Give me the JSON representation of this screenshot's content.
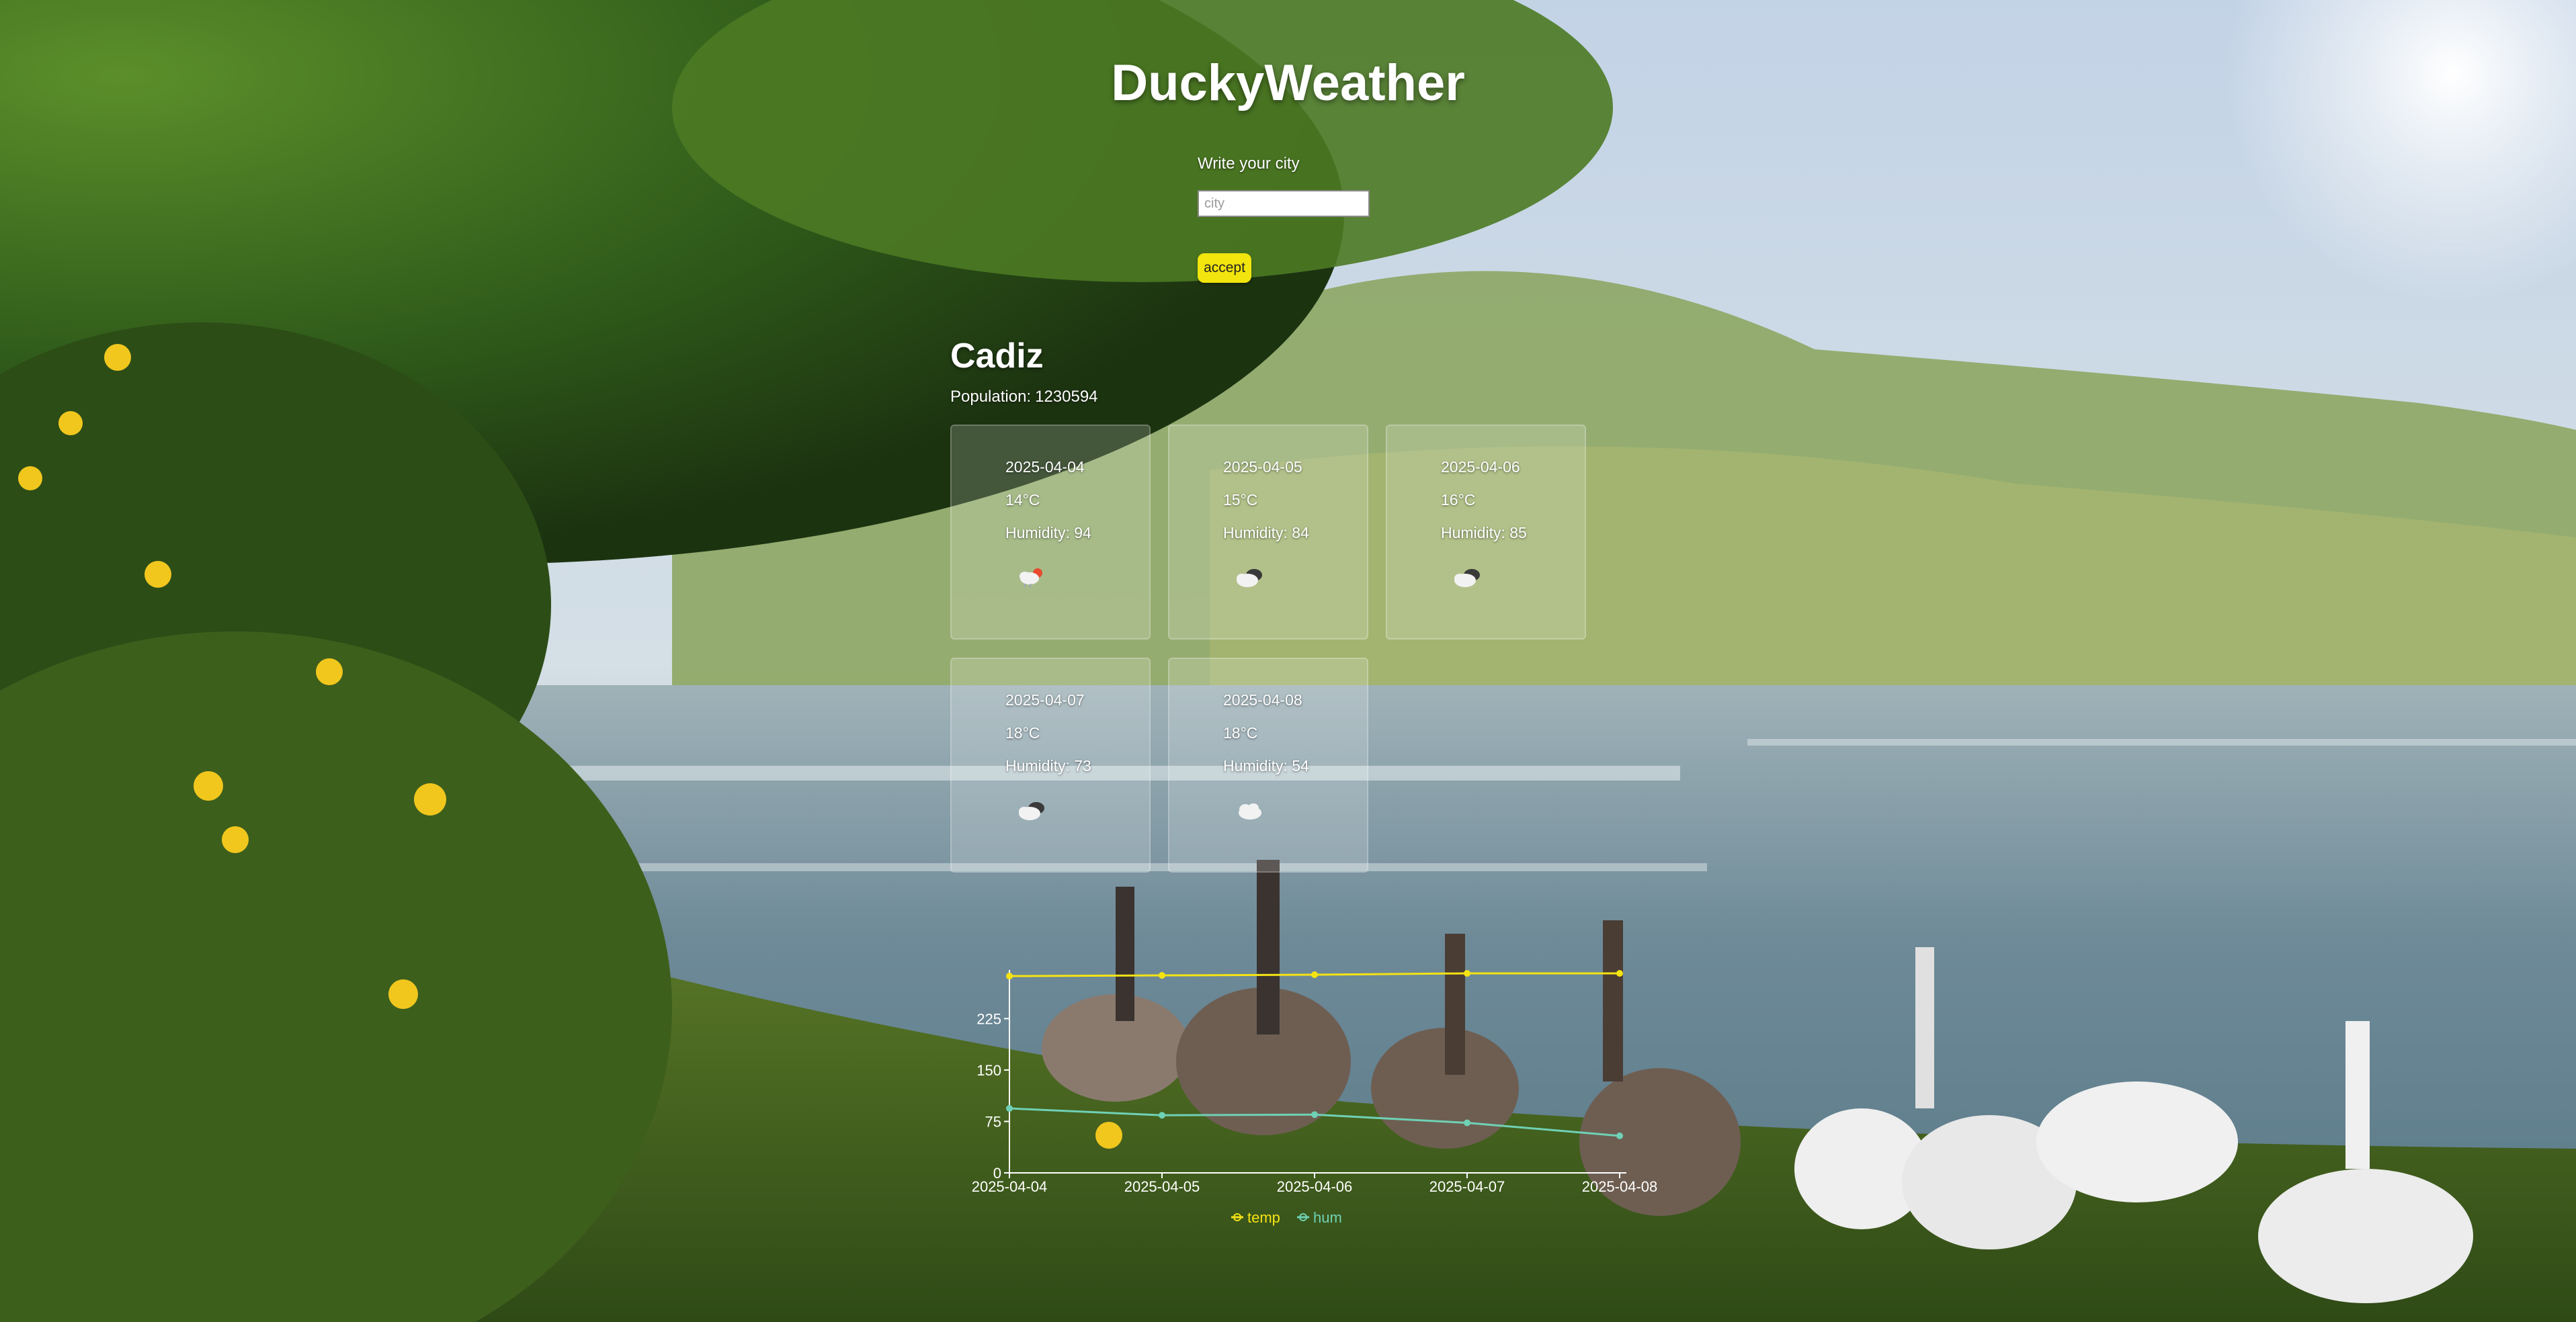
{
  "app": {
    "title": "DuckyWeather"
  },
  "search": {
    "label": "Write your city",
    "placeholder": "city",
    "value": "",
    "accept_label": "accept"
  },
  "city": {
    "name": "Cadiz",
    "population_label": "Population:",
    "population": "1230594"
  },
  "colors": {
    "accent_yellow": "#f2e50d",
    "temp_series": "#f5e313",
    "hum_series": "#6fd1b5"
  },
  "forecast": [
    {
      "date": "2025-04-04",
      "temp": "14°C",
      "humidity": "Humidity: 94",
      "icon": "cloud-rain-sun-icon"
    },
    {
      "date": "2025-04-05",
      "temp": "15°C",
      "humidity": "Humidity: 84",
      "icon": "dark-cloud-icon"
    },
    {
      "date": "2025-04-06",
      "temp": "16°C",
      "humidity": "Humidity: 85",
      "icon": "dark-cloud-icon"
    },
    {
      "date": "2025-04-07",
      "temp": "18°C",
      "humidity": "Humidity: 73",
      "icon": "dark-cloud-icon"
    },
    {
      "date": "2025-04-08",
      "temp": "18°C",
      "humidity": "Humidity: 54",
      "icon": "cloud-icon"
    }
  ],
  "chart_data": {
    "type": "line",
    "categories": [
      "2025-04-04",
      "2025-04-05",
      "2025-04-06",
      "2025-04-07",
      "2025-04-08"
    ],
    "series": [
      {
        "name": "temp",
        "values": [
          287,
          288,
          289,
          291,
          291
        ]
      },
      {
        "name": "hum",
        "values": [
          94,
          84,
          85,
          73,
          54
        ]
      }
    ],
    "yticks": [
      0,
      75,
      150,
      225
    ],
    "ylim": [
      0,
      290
    ],
    "grid": false,
    "legend": "bottom-center"
  }
}
